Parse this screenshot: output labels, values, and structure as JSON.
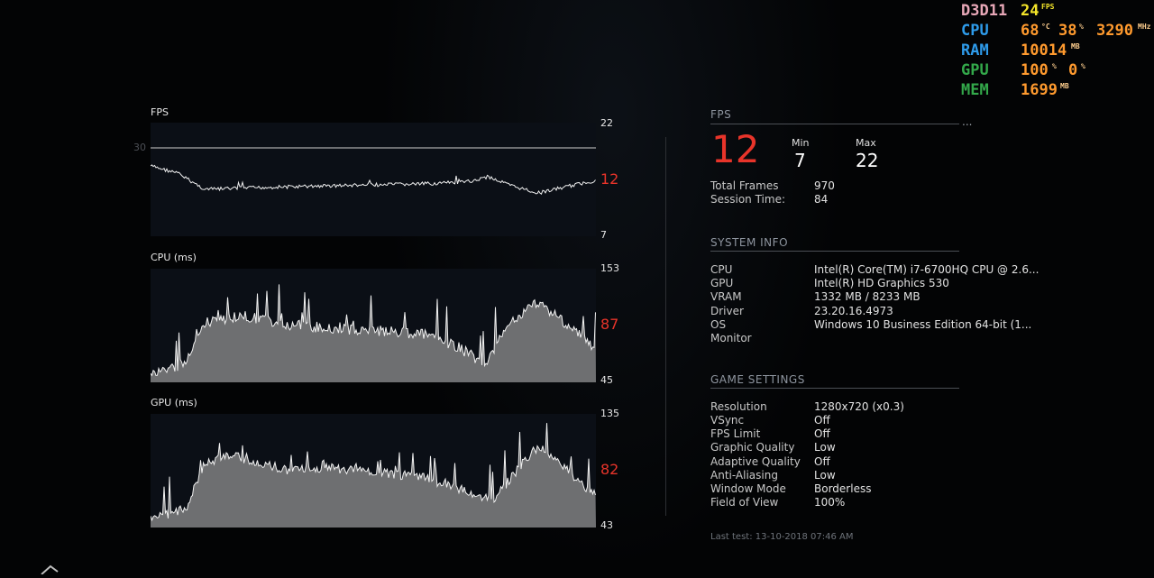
{
  "overlay": {
    "api": "D3D11",
    "fps_value": "24",
    "fps_unit": "FPS",
    "cpu_label": "CPU",
    "cpu_temp": "68",
    "cpu_temp_unit": "°C",
    "cpu_load": "38",
    "cpu_load_unit": "%",
    "cpu_clock": "3290",
    "cpu_clock_unit": "MHz",
    "ram_label": "RAM",
    "ram_value": "10014",
    "ram_unit": "MB",
    "gpu_label": "GPU",
    "gpu_load": "100",
    "gpu_load_unit": "%",
    "gpu_load2": "0",
    "gpu_load2_unit": "%",
    "mem_label": "MEM",
    "mem_value": "1699",
    "mem_unit": "MB",
    "colors": {
      "api": "#e8a8b8",
      "fps": "#f5e62a",
      "cpu": "#2e9bea",
      "ram": "#2e9bea",
      "gpu": "#33a84a",
      "mem": "#33a84a",
      "value": "#ff9a2e"
    }
  },
  "charts": {
    "fps": {
      "title": "FPS",
      "max": "22",
      "min": "7",
      "current": "12",
      "target": "30"
    },
    "cpu": {
      "title": "CPU (ms)",
      "max": "153",
      "min": "45",
      "current": "87"
    },
    "gpu": {
      "title": "GPU (ms)",
      "max": "135",
      "min": "43",
      "current": "82"
    }
  },
  "fps_panel": {
    "heading": "FPS",
    "current": "12",
    "min_label": "Min",
    "min_value": "7",
    "max_label": "Max",
    "max_value": "22",
    "total_frames_label": "Total Frames",
    "total_frames_value": "970",
    "session_time_label": "Session Time:",
    "session_time_value": "84"
  },
  "system_info": {
    "heading": "SYSTEM INFO",
    "rows": [
      {
        "label": "CPU",
        "value": "Intel(R) Core(TM) i7-6700HQ CPU @ 2.6..."
      },
      {
        "label": "GPU",
        "value": "Intel(R) HD Graphics 530"
      },
      {
        "label": "VRAM",
        "value": "1332 MB / 8233 MB"
      },
      {
        "label": "Driver",
        "value": "23.20.16.4973"
      },
      {
        "label": "OS",
        "value": "Windows 10 Business Edition 64-bit (1..."
      },
      {
        "label": "Monitor",
        "value": ""
      }
    ]
  },
  "game_settings": {
    "heading": "GAME SETTINGS",
    "rows": [
      {
        "label": "Resolution",
        "value": "1280x720 (x0.3)"
      },
      {
        "label": "VSync",
        "value": "Off"
      },
      {
        "label": "FPS Limit",
        "value": "Off"
      },
      {
        "label": "Graphic Quality",
        "value": "Low"
      },
      {
        "label": "Adaptive Quality",
        "value": "Off"
      },
      {
        "label": "Anti-Aliasing",
        "value": "Low"
      },
      {
        "label": "Window Mode",
        "value": "Borderless"
      },
      {
        "label": "Field of View",
        "value": "100%"
      }
    ]
  },
  "footer": {
    "last_test": "Last test: 13-10-2018 07:46 AM"
  },
  "more_indicator": "..."
}
